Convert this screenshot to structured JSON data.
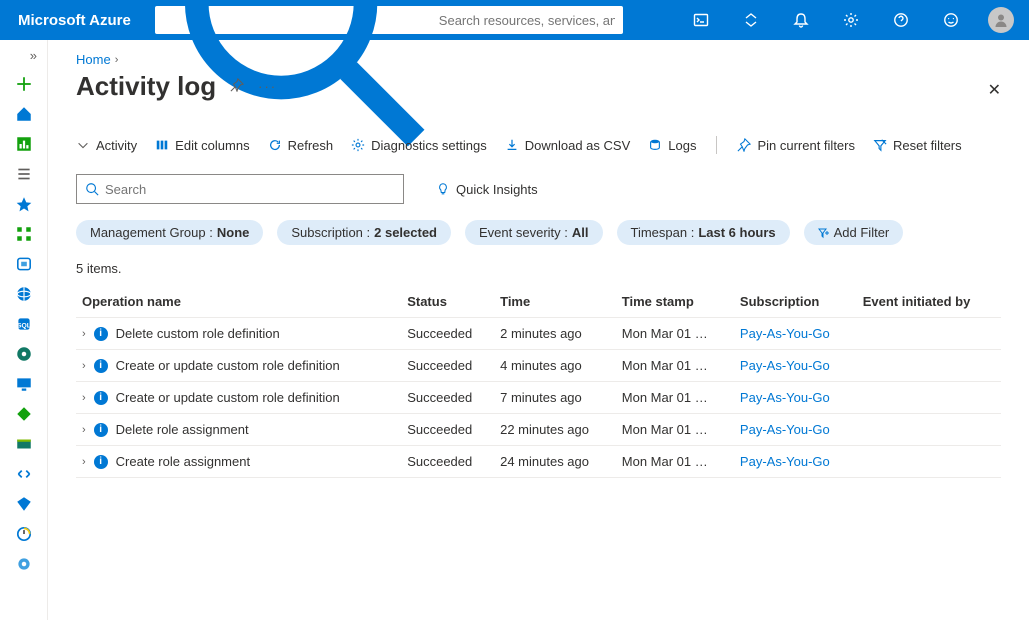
{
  "topbar": {
    "brand": "Microsoft Azure",
    "search_placeholder": "Search resources, services, and docs (G+/)"
  },
  "breadcrumb": {
    "home": "Home"
  },
  "page": {
    "title": "Activity log"
  },
  "toolbar": {
    "activity": "Activity",
    "edit_columns": "Edit columns",
    "refresh": "Refresh",
    "diag": "Diagnostics settings",
    "download": "Download as CSV",
    "logs": "Logs",
    "pin": "Pin current filters",
    "reset": "Reset filters"
  },
  "search": {
    "placeholder": "Search"
  },
  "quick_insights": "Quick Insights",
  "pills": {
    "mg_label": "Management Group : ",
    "mg_value": "None",
    "sub_label": "Subscription : ",
    "sub_value": "2 selected",
    "sev_label": "Event severity : ",
    "sev_value": "All",
    "ts_label": "Timespan : ",
    "ts_value": "Last 6 hours",
    "add_filter": "Add Filter"
  },
  "items_count": "5 items.",
  "columns": {
    "op": "Operation name",
    "status": "Status",
    "time": "Time",
    "stamp": "Time stamp",
    "sub": "Subscription",
    "init": "Event initiated by"
  },
  "rows": [
    {
      "op": "Delete custom role definition",
      "status": "Succeeded",
      "time": "2 minutes ago",
      "stamp": "Mon Mar 01 …",
      "sub": "Pay-As-You-Go",
      "init": ""
    },
    {
      "op": "Create or update custom role definition",
      "status": "Succeeded",
      "time": "4 minutes ago",
      "stamp": "Mon Mar 01 …",
      "sub": "Pay-As-You-Go",
      "init": ""
    },
    {
      "op": "Create or update custom role definition",
      "status": "Succeeded",
      "time": "7 minutes ago",
      "stamp": "Mon Mar 01 …",
      "sub": "Pay-As-You-Go",
      "init": ""
    },
    {
      "op": "Delete role assignment",
      "status": "Succeeded",
      "time": "22 minutes ago",
      "stamp": "Mon Mar 01 …",
      "sub": "Pay-As-You-Go",
      "init": ""
    },
    {
      "op": "Create role assignment",
      "status": "Succeeded",
      "time": "24 minutes ago",
      "stamp": "Mon Mar 01 …",
      "sub": "Pay-As-You-Go",
      "init": ""
    }
  ]
}
